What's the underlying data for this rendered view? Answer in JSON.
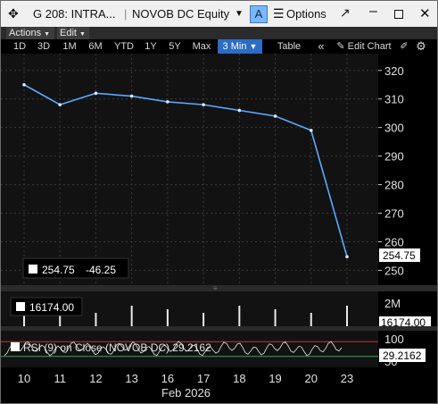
{
  "window": {
    "title": "G 208: INTRA...",
    "security": "NOVOB DC Equity",
    "badge": "A",
    "options_label": "Options"
  },
  "menu": {
    "actions": "Actions",
    "edit": "Edit"
  },
  "toolbar": {
    "ranges": [
      "1D",
      "3D",
      "1M",
      "6M",
      "YTD",
      "1Y",
      "5Y",
      "Max"
    ],
    "interval": "3 Min",
    "table": "Table",
    "edit_chart": "Edit Chart"
  },
  "colors": {
    "price_line": "#5aa8ff",
    "accent": "#2c6cc4",
    "rsi_upper": "#c0392b",
    "rsi_lower": "#27ae60"
  },
  "price_panel": {
    "y_ticks": [
      320,
      310,
      300,
      290,
      280,
      270,
      260,
      250
    ],
    "last_label": "254.75",
    "legend_value": "254.75",
    "legend_change": "-46.25"
  },
  "volume_panel": {
    "y_tick": "2M",
    "last_label": "16174.00",
    "legend_value": "16174.00"
  },
  "rsi_panel": {
    "y_ticks": [
      100,
      50
    ],
    "last_label": "29.2162",
    "legend_text": "RSI (9) on Close (NOVOB DC) 29.2162",
    "upper_level": 70,
    "lower_level": 30
  },
  "x_axis": {
    "ticks": [
      "10",
      "11",
      "12",
      "13",
      "16",
      "17",
      "18",
      "19",
      "20",
      "23"
    ],
    "month_label": "Feb 2026"
  },
  "chart_data": {
    "type": "line",
    "x": [
      "10",
      "11",
      "12",
      "13",
      "16",
      "17",
      "18",
      "19",
      "20",
      "23"
    ],
    "series": [
      {
        "values": [
          315,
          308,
          312,
          311,
          309,
          308,
          306,
          304,
          299,
          254.75
        ]
      }
    ],
    "ylim": [
      247,
      324
    ]
  }
}
